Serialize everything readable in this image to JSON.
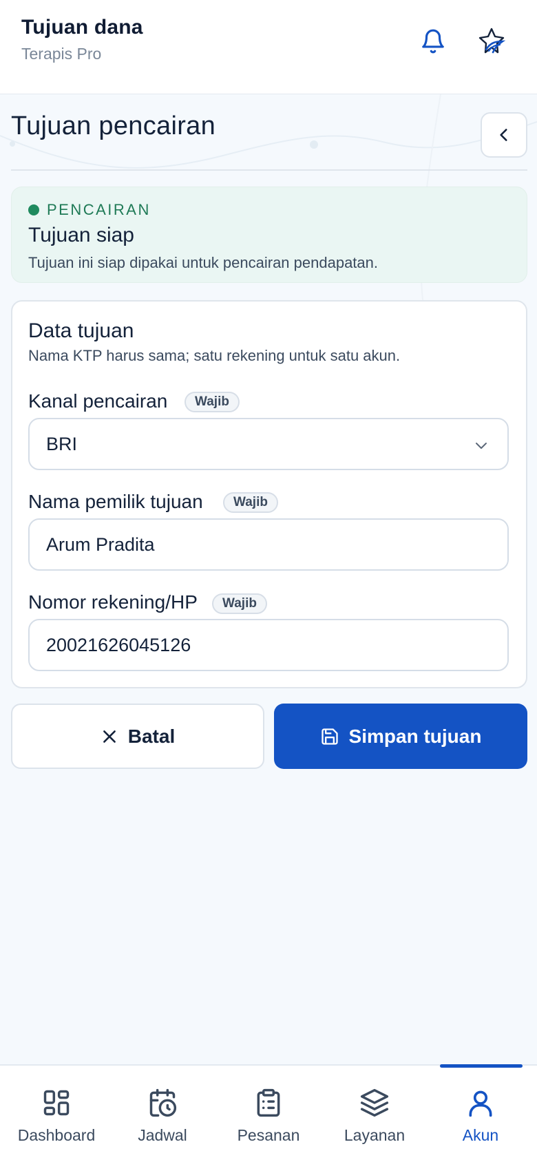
{
  "header": {
    "title": "Tujuan dana",
    "subtitle": "Terapis Pro",
    "icons": [
      "bell-icon",
      "brand-logo-icon"
    ]
  },
  "page": {
    "title": "Tujuan pencairan",
    "back_icon": "chevron-left-icon"
  },
  "status": {
    "kicker": "PENCAIRAN",
    "title": "Tujuan siap",
    "description": "Tujuan ini siap dipakai untuk pencairan pendapatan.",
    "color": "#1f8a5e"
  },
  "form": {
    "title": "Data tujuan",
    "description": "Nama KTP harus sama; satu rekening untuk satu akun.",
    "required_badge": "Wajib",
    "fields": [
      {
        "label": "Kanal pencairan",
        "value": "BRI",
        "type": "select"
      },
      {
        "label": "Nama pemilik tujuan",
        "value": "Arum Pradita",
        "type": "text"
      },
      {
        "label": "Nomor rekening/HP",
        "value": "20021626045126",
        "type": "text"
      }
    ]
  },
  "actions": {
    "cancel_label": "Batal",
    "save_label": "Simpan tujuan",
    "primary_color": "#1453c4"
  },
  "nav": {
    "items": [
      {
        "label": "Dashboard",
        "icon": "dashboard-icon"
      },
      {
        "label": "Jadwal",
        "icon": "calendar-clock-icon"
      },
      {
        "label": "Pesanan",
        "icon": "clipboard-list-icon"
      },
      {
        "label": "Layanan",
        "icon": "layers-icon"
      },
      {
        "label": "Akun",
        "icon": "user-icon",
        "active": true
      }
    ]
  }
}
